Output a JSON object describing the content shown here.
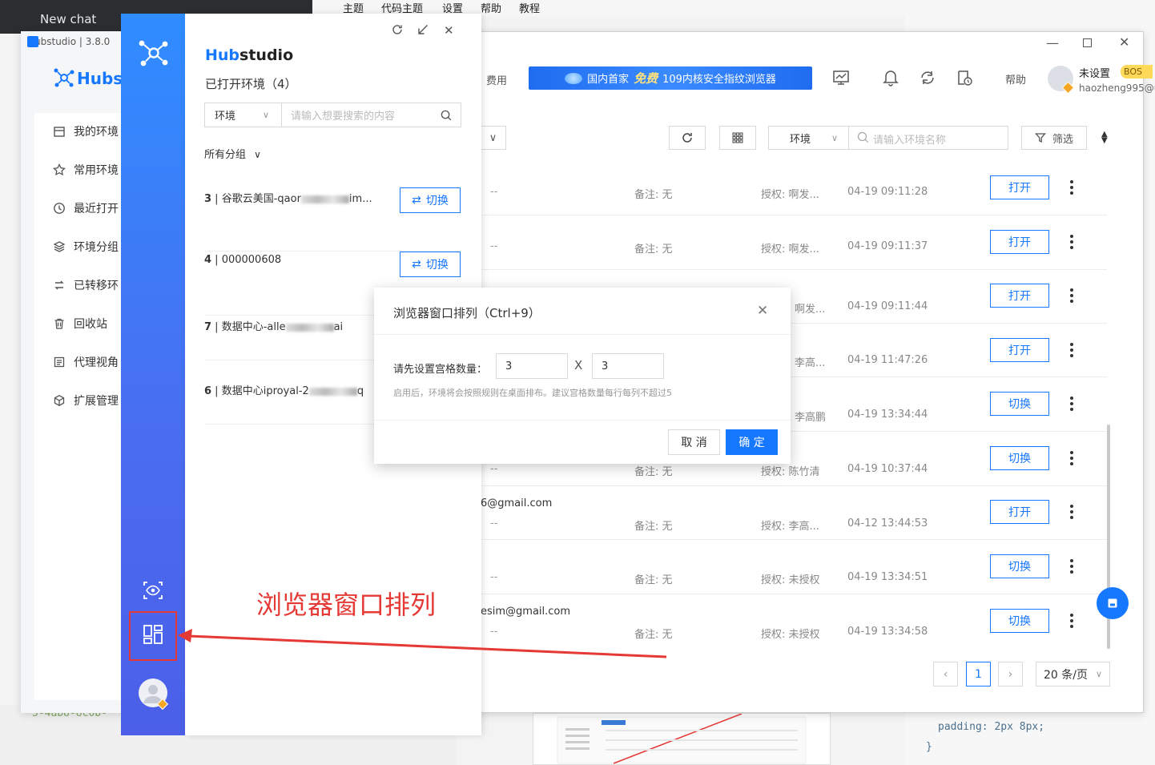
{
  "background": {
    "chat_tab": "New chat",
    "menu": [
      "主题",
      "代码主题",
      "设置",
      "帮助",
      "教程"
    ],
    "code_line1": "padding: 2px 8px;",
    "code_line2": "}",
    "code_left": "5-4ab8-8c0b-"
  },
  "main_window": {
    "title": "Hubstudio | 3.8.0",
    "logo": "Hubst",
    "nav": [
      "我的环境",
      "常用环境",
      "最近打开",
      "环境分组",
      "已转移环",
      "回收站",
      "代理视角",
      "扩展管理"
    ],
    "topbar": {
      "fee": "费用",
      "banner_pre": "国内首家",
      "banner_free": "免费",
      "banner_post": "109内核安全指纹浏览器",
      "help": "帮助",
      "user_name": "未设置",
      "user_badge": "BOS",
      "user_email": "haozheng995@ul"
    },
    "toolbar": {
      "env_select": "环境",
      "search_placeholder": "请输入环境名称",
      "filter": "筛选"
    },
    "rows": [
      {
        "dash": "--",
        "note": "备注: 无",
        "auth": "授权: 啊发...",
        "time": "04-19 09:11:28",
        "btn": "打开",
        "email": ""
      },
      {
        "dash": "--",
        "note": "备注: 无",
        "auth": "授权: 啊发...",
        "time": "04-19 09:11:37",
        "btn": "打开",
        "email": ""
      },
      {
        "dash": "",
        "note": "",
        "auth": "啊发...",
        "time": "04-19 09:11:44",
        "btn": "打开",
        "email": ""
      },
      {
        "dash": "",
        "note": "",
        "auth": "李高...",
        "time": "04-19 11:47:26",
        "btn": "打开",
        "email": ""
      },
      {
        "dash": "",
        "note": "",
        "auth": "李高鹏",
        "time": "04-19 13:34:44",
        "btn": "切换",
        "email": ""
      },
      {
        "dash": "--",
        "note": "备注: 无",
        "auth": "授权: 陈竹清",
        "time": "04-19 10:37:44",
        "btn": "切换",
        "email": ""
      },
      {
        "dash": "--",
        "note": "备注: 无",
        "auth": "授权: 李高...",
        "time": "04-12 13:44:53",
        "btn": "打开",
        "email": "6@gmail.com"
      },
      {
        "dash": "--",
        "note": "备注: 无",
        "auth": "授权: 未授权",
        "time": "04-19 13:34:51",
        "btn": "切换",
        "email": ""
      },
      {
        "dash": "--",
        "note": "备注: 无",
        "auth": "授权: 未授权",
        "time": "04-19 13:34:58",
        "btn": "切换",
        "email": "esim@gmail.com"
      }
    ],
    "pager": {
      "current": "1",
      "page_size": "20 条/页"
    }
  },
  "popup": {
    "title_hub": "Hub",
    "title_rest": "studio",
    "subtitle": "已打开环境（4）",
    "select": "环境",
    "search_placeholder": "请输入想要搜索的内容",
    "group": "所有分组",
    "switch_label": "切换",
    "items": [
      {
        "num": "3",
        "name_pre": "谷歌云美国-qaor",
        "name_post": "im..."
      },
      {
        "num": "4",
        "name_pre": "000000608",
        "name_post": ""
      },
      {
        "num": "7",
        "name_pre": "数据中心-alle",
        "name_post": "ai"
      },
      {
        "num": "6",
        "name_pre": "数据中心iproyal-2",
        "name_post": "q"
      }
    ]
  },
  "dialog": {
    "title": "浏览器窗口排列（Ctrl+9）",
    "label": "请先设置宫格数量：",
    "cols": "3",
    "times": "X",
    "rows": "3",
    "hint": "启用后，环境将会按照规则在桌面排布。建议宫格数量每行每列不超过5",
    "cancel": "取 消",
    "ok": "确 定"
  },
  "annotation": {
    "text": "浏览器窗口排列",
    "color": "#e53935"
  },
  "colors": {
    "primary": "#1677ff",
    "sidebar_top": "#2f8dff",
    "sidebar_bottom": "#4b5fe8"
  }
}
